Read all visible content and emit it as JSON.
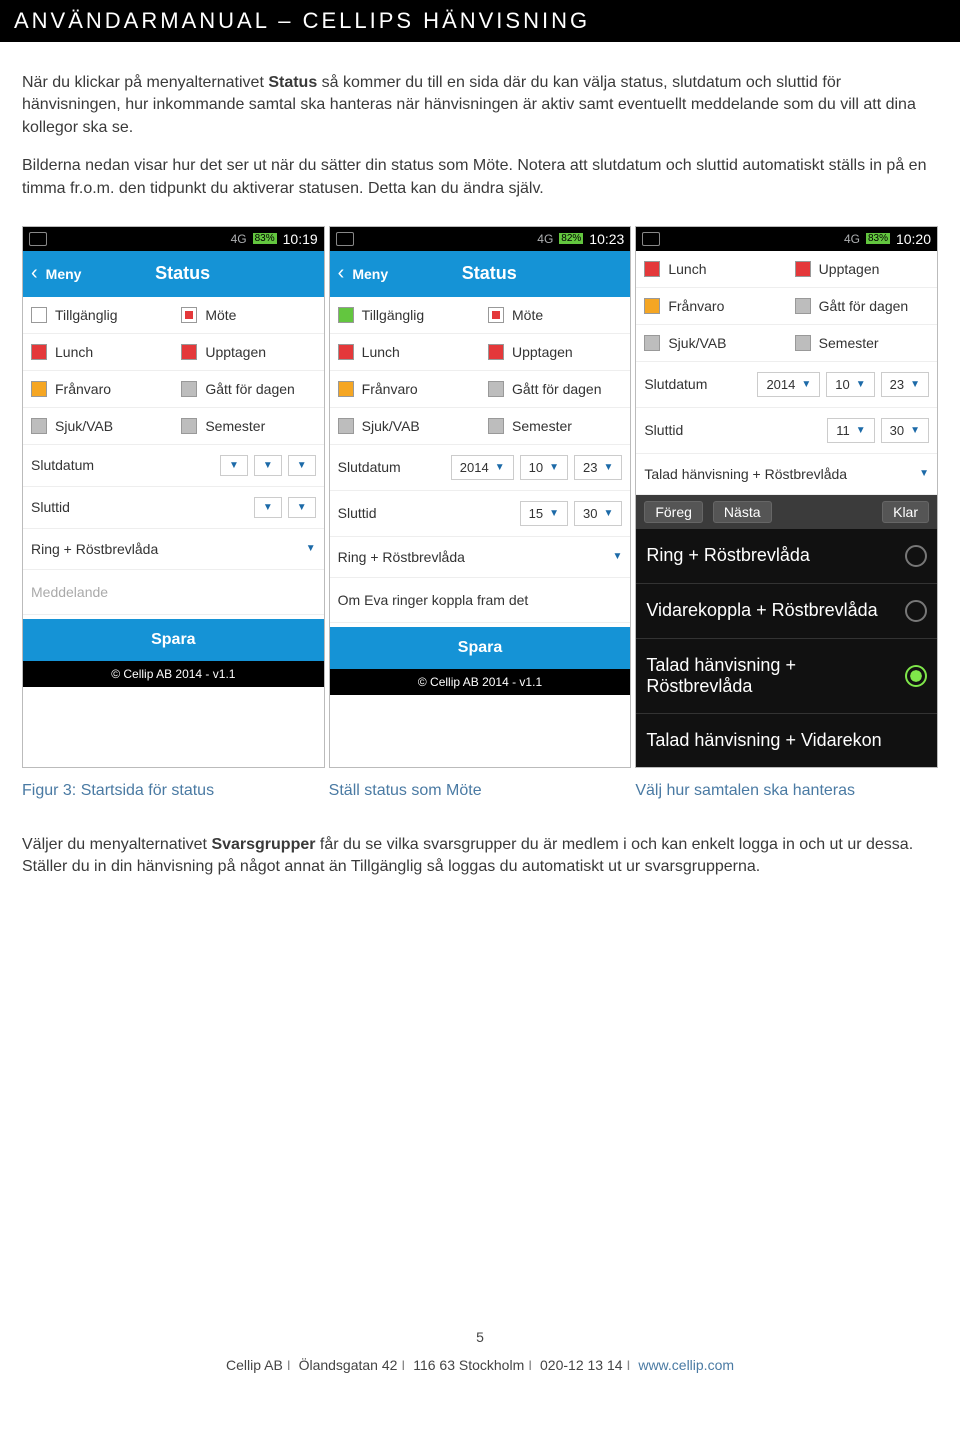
{
  "header": "ANVÄNDARMANUAL – CELLIPS HÄNVISNING",
  "para1a": "När du klickar på menyalternativet ",
  "para1b_bold": "Status",
  "para1c": " så kommer du till en sida där du kan välja status, slutdatum och sluttid för hänvisningen, hur inkommande samtal ska hanteras när hänvisningen är aktiv samt eventuellt meddelande som du vill att dina kollegor ska se.",
  "para2": "Bilderna nedan visar hur det ser ut när du sätter din status som Möte. Notera att slutdatum och sluttid automatiskt ställs in på en timma fr.o.m. den tidpunkt du aktiverar statusen. Detta kan du ändra själv.",
  "screens": {
    "s1": {
      "battery": "83%",
      "clock": "10:19",
      "back": "Meny",
      "title": "Status",
      "statuses": [
        {
          "label": "Tillgänglig",
          "color": "white"
        },
        {
          "label": "Möte",
          "color": "red-inner"
        },
        {
          "label": "Lunch",
          "color": "red"
        },
        {
          "label": "Upptagen",
          "color": "red"
        },
        {
          "label": "Frånvaro",
          "color": "orange"
        },
        {
          "label": "Gått för dagen",
          "color": "grey"
        },
        {
          "label": "Sjuk/VAB",
          "color": "grey"
        },
        {
          "label": "Semester",
          "color": "grey"
        }
      ],
      "slutdatum_label": "Slutdatum",
      "slutdatum": [
        "",
        "",
        ""
      ],
      "sluttid_label": "Sluttid",
      "sluttid": [
        "",
        ""
      ],
      "ring": "Ring + Röstbrevlåda",
      "msg_placeholder": "Meddelande",
      "save": "Spara",
      "copyright": "© Cellip AB 2014 - v1.1"
    },
    "s2": {
      "battery": "82%",
      "clock": "10:23",
      "back": "Meny",
      "title": "Status",
      "statuses": [
        {
          "label": "Tillgänglig",
          "color": "green"
        },
        {
          "label": "Möte",
          "color": "red-inner"
        },
        {
          "label": "Lunch",
          "color": "red"
        },
        {
          "label": "Upptagen",
          "color": "red"
        },
        {
          "label": "Frånvaro",
          "color": "orange"
        },
        {
          "label": "Gått för dagen",
          "color": "grey"
        },
        {
          "label": "Sjuk/VAB",
          "color": "grey"
        },
        {
          "label": "Semester",
          "color": "grey"
        }
      ],
      "slutdatum_label": "Slutdatum",
      "slutdatum": [
        "2014",
        "10",
        "23"
      ],
      "sluttid_label": "Sluttid",
      "sluttid": [
        "15",
        "30"
      ],
      "ring": "Ring + Röstbrevlåda",
      "msg_value": "Om Eva ringer koppla fram det",
      "save": "Spara",
      "copyright": "© Cellip AB 2014 - v1.1"
    },
    "s3": {
      "battery": "83%",
      "clock": "10:20",
      "statuses_top": [
        {
          "label": "Lunch",
          "color": "red"
        },
        {
          "label": "Upptagen",
          "color": "red"
        },
        {
          "label": "Frånvaro",
          "color": "orange"
        },
        {
          "label": "Gått för dagen",
          "color": "grey"
        },
        {
          "label": "Sjuk/VAB",
          "color": "grey"
        },
        {
          "label": "Semester",
          "color": "grey"
        }
      ],
      "slutdatum_label": "Slutdatum",
      "slutdatum": [
        "2014",
        "10",
        "23"
      ],
      "sluttid_label": "Sluttid",
      "sluttid": [
        "11",
        "30"
      ],
      "ring": "Talad hänvisning + Röstbrevlåda",
      "kbd": {
        "prev": "Föreg",
        "next": "Nästa",
        "done": "Klar"
      },
      "options": [
        {
          "label": "Ring + Röstbrevlåda",
          "sel": false
        },
        {
          "label": "Vidarekoppla + Röstbrevlåda",
          "sel": false
        },
        {
          "label": "Talad hänvisning + Röstbrevlåda",
          "sel": true
        },
        {
          "label": "Talad hänvisning + Vidarekon",
          "sel": false
        }
      ]
    }
  },
  "captions": {
    "c1": "Figur 3: Startsida för status",
    "c2": "Ställ status som Möte",
    "c3": "Välj hur samtalen ska hanteras"
  },
  "para3a": "Väljer du menyalternativet ",
  "para3b_bold": "Svarsgrupper",
  "para3c": " får du se vilka svarsgrupper du är medlem i och kan enkelt logga in och ut ur dessa. Ställer du in din hänvisning på något annat än Tillgänglig så loggas du automatiskt ut ur svarsgrupperna.",
  "page_number": "5",
  "footer": {
    "company": "Cellip AB",
    "addr": "Ölandsgatan 42",
    "post": "116 63 Stockholm",
    "tel": "020-12 13 14",
    "url": "www.cellip.com"
  }
}
